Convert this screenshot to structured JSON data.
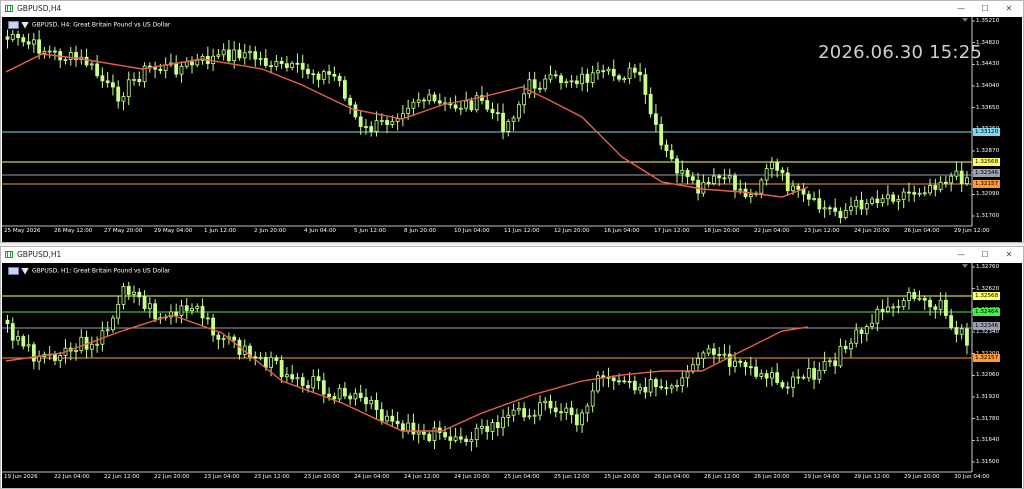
{
  "h4": {
    "title": "GBPUSD,H4",
    "legend": "GBPUSD, H4:  Great Britain Pound vs US Dollar",
    "clock": "2026.06.30 15:25",
    "price_labels": [
      "1.35210",
      "1.34820",
      "1.34430",
      "1.34040",
      "1.33650",
      "1.33260",
      "1.32870",
      "1.32480",
      "1.32090",
      "1.31700"
    ],
    "time_labels": [
      "25 May 2026",
      "26 May 12:00",
      "27 May 20:00",
      "29 May 04:00",
      "1 Jun 12:00",
      "2 Jun 20:00",
      "4 Jun 04:00",
      "5 Jun 12:00",
      "8 Jun 20:00",
      "10 Jun 04:00",
      "11 Jun 12:00",
      "12 Jun 20:00",
      "16 Jun 04:00",
      "17 Jun 12:00",
      "18 Jun 20:00",
      "22 Jun 04:00",
      "23 Jun 12:00",
      "24 Jun 20:00",
      "26 Jun 04:00",
      "29 Jun 12:00"
    ],
    "levels": [
      {
        "label": "1.33120",
        "color": "#7fd6f0",
        "bg": "#7fd6f0"
      },
      {
        "label": "1.32568",
        "color": "#ffff66",
        "bg": "#ffff66"
      },
      {
        "label": "1.32346",
        "color": "#9aa0b0",
        "bg": "#9aa0b0"
      },
      {
        "label": "1.32157",
        "color": "#ff9a2e",
        "bg": "#ff9a2e"
      }
    ]
  },
  "h1": {
    "title": "GBPUSD,H1",
    "legend": "GBPUSD, H1:  Great Britain Pound vs US Dollar",
    "price_labels": [
      "1.32760",
      "1.32620",
      "1.32480",
      "1.32340",
      "1.32200",
      "1.32060",
      "1.31920",
      "1.31780",
      "1.31640",
      "1.31500"
    ],
    "time_labels": [
      "19 Jun 2026",
      "22 Jun 04:00",
      "22 Jun 12:00",
      "22 Jun 20:00",
      "23 Jun 04:00",
      "23 Jun 12:00",
      "23 Jun 20:00",
      "24 Jun 04:00",
      "24 Jun 12:00",
      "24 Jun 20:00",
      "25 Jun 04:00",
      "25 Jun 12:00",
      "25 Jun 20:00",
      "26 Jun 04:00",
      "26 Jun 12:00",
      "26 Jun 20:00",
      "29 Jun 04:00",
      "29 Jun 12:00",
      "29 Jun 20:00",
      "30 Jun 04:00"
    ],
    "levels": [
      {
        "label": "1.32568",
        "color": "#ffff66",
        "bg": "#ffff66"
      },
      {
        "label": "1.32464",
        "color": "#44ee44",
        "bg": "#44ee44"
      },
      {
        "label": "1.32346",
        "color": "#9aa0b0",
        "bg": "#9aa0b0"
      },
      {
        "label": "1.32157",
        "color": "#ff9a2e",
        "bg": "#ff9a2e"
      }
    ]
  },
  "colors": {
    "candle": "#c8ff8a",
    "ma": "#e8604a",
    "bg": "#000000"
  },
  "window_buttons": [
    "—",
    "☐",
    "✕"
  ]
}
